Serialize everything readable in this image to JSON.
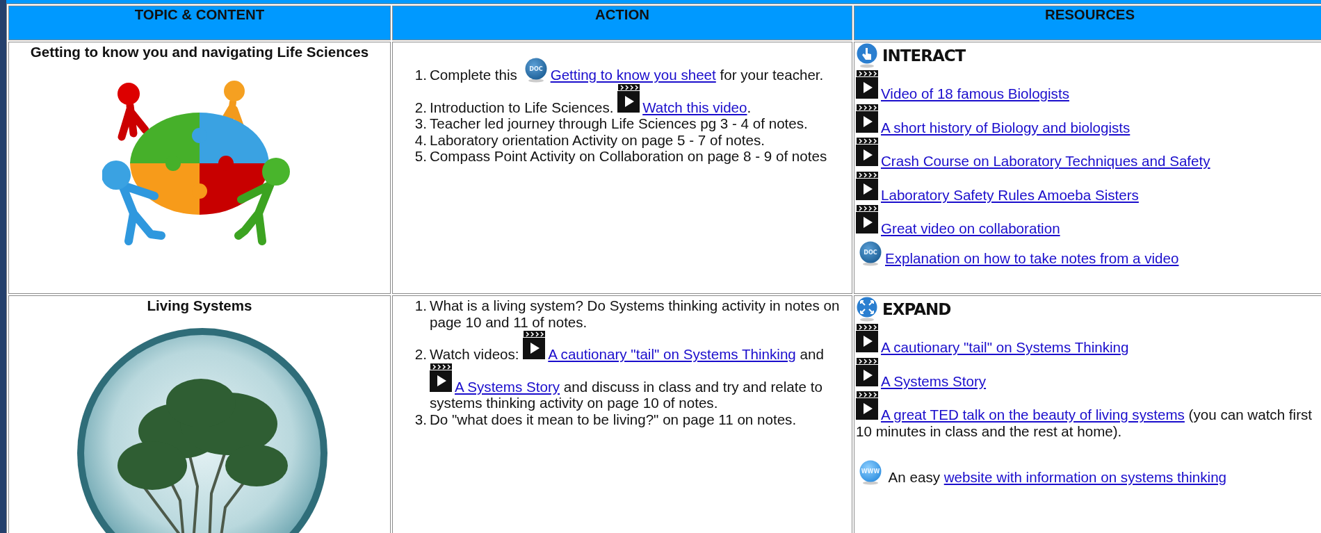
{
  "table": {
    "columns": [
      "TOPIC & CONTENT",
      "ACTION",
      "RESOURCES"
    ],
    "rows": [
      {
        "topic": {
          "title": "Getting to know you and navigating Life Sciences"
        },
        "steps": [
          {
            "marker": "1.",
            "parts": [
              {
                "kind": "text",
                "text": "Complete this "
              },
              {
                "kind": "doc_icon",
                "label": "DOC"
              },
              {
                "kind": "link",
                "text": "Getting to know you sheet"
              },
              {
                "kind": "text",
                "text": " for your teacher."
              }
            ]
          },
          {
            "marker": "2.",
            "parts": [
              {
                "kind": "text",
                "text": "Introduction to Life Sciences. "
              },
              {
                "kind": "video_icon"
              },
              {
                "kind": "link",
                "text": "Watch this video"
              },
              {
                "kind": "text",
                "text": "."
              }
            ]
          },
          {
            "marker": "3.",
            "parts": [
              {
                "kind": "text",
                "text": "Teacher led journey through Life Sciences pg 3 - 4 of notes."
              }
            ]
          },
          {
            "marker": "4.",
            "parts": [
              {
                "kind": "text",
                "text": "Laboratory orientation Activity on page 5 - 7 of notes."
              }
            ]
          },
          {
            "marker": "5.",
            "parts": [
              {
                "kind": "text",
                "text": "Compass Point Activity on Collaboration on page 8 - 9 of notes"
              }
            ]
          }
        ],
        "resources": {
          "heading": "INTERACT",
          "items": [
            {
              "parts": [
                {
                  "kind": "video_icon"
                },
                {
                  "kind": "link",
                  "text": "Video of 18 famous Biologists"
                }
              ]
            },
            {
              "parts": [
                {
                  "kind": "video_icon"
                },
                {
                  "kind": "link",
                  "text": "A short history of Biology and biologists"
                }
              ]
            },
            {
              "parts": [
                {
                  "kind": "video_icon"
                },
                {
                  "kind": "link",
                  "text": "Crash Course on Laboratory Techniques and Safety"
                }
              ]
            },
            {
              "parts": [
                {
                  "kind": "video_icon"
                },
                {
                  "kind": "link",
                  "text": "Laboratory Safety Rules Amoeba Sisters"
                }
              ]
            },
            {
              "parts": [
                {
                  "kind": "video_icon"
                },
                {
                  "kind": "link",
                  "text": "Great video on collaboration"
                }
              ]
            },
            {
              "parts": [
                {
                  "kind": "doc_icon",
                  "label": "DOC"
                },
                {
                  "kind": "link",
                  "text": "Explanation on how to take notes from a video"
                }
              ]
            }
          ]
        }
      },
      {
        "topic": {
          "title": "Living Systems"
        },
        "steps": [
          {
            "marker": "1.",
            "parts": [
              {
                "kind": "text",
                "text": "What is a living system? Do Systems thinking activity in notes on page 10 and 11 of notes."
              }
            ]
          },
          {
            "marker": "2.",
            "parts": [
              {
                "kind": "text",
                "text": "Watch videos: "
              },
              {
                "kind": "video_icon"
              },
              {
                "kind": "link",
                "text": "A cautionary \"tail\" on Systems Thinking"
              },
              {
                "kind": "text",
                "text": " and "
              },
              {
                "kind": "video_icon"
              },
              {
                "kind": "link",
                "text": "A Systems Story"
              },
              {
                "kind": "text",
                "text": " and discuss in class and try and relate to systems thinking activity on page 10 of notes."
              }
            ]
          },
          {
            "marker": "3.",
            "parts": [
              {
                "kind": "text",
                "text": "Do \"what does it mean to be living?\" on page 11 on notes."
              }
            ]
          }
        ],
        "resources": {
          "heading": "EXPAND",
          "items": [
            {
              "parts": [
                {
                  "kind": "video_icon"
                },
                {
                  "kind": "link",
                  "text": "A cautionary \"tail\" on Systems Thinking"
                }
              ]
            },
            {
              "parts": [
                {
                  "kind": "video_icon"
                },
                {
                  "kind": "link",
                  "text": "A Systems Story"
                }
              ]
            },
            {
              "parts": [
                {
                  "kind": "video_icon"
                },
                {
                  "kind": "link",
                  "text": "A great TED talk on the beauty of living systems"
                },
                {
                  "kind": "text",
                  "text": " (you can watch first 10 minutes in class and the rest at home)."
                }
              ]
            },
            {
              "parts": [
                {
                  "kind": "www_icon",
                  "label": "WWW"
                },
                {
                  "kind": "text",
                  "text": " An easy "
                },
                {
                  "kind": "link",
                  "text": "website with information on systems thinking"
                }
              ]
            }
          ]
        }
      }
    ]
  }
}
